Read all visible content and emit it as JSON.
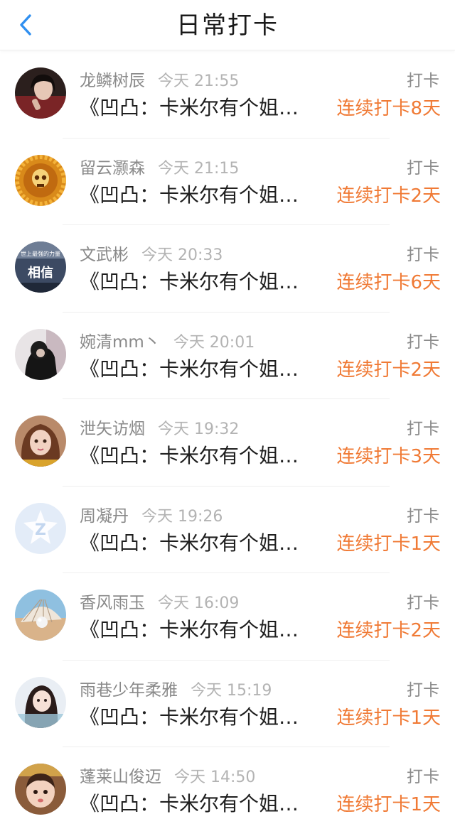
{
  "header": {
    "title": "日常打卡",
    "back_icon": "chevron-left-icon",
    "accent": "#2f8ff0"
  },
  "colors": {
    "streak": "#f07a35",
    "muted": "#8a8a8a"
  },
  "items": [
    {
      "name": "龙鳞树辰",
      "time": "今天 21:55",
      "tag": "打卡",
      "content": "《凹凸：卡米尔有个姐…",
      "streak": "连续打卡8天",
      "avatar": "avatar-girl-dark"
    },
    {
      "name": "留云灏森",
      "time": "今天 21:15",
      "tag": "打卡",
      "content": "《凹凸：卡米尔有个姐…",
      "streak": "连续打卡2天",
      "avatar": "avatar-golden-skull"
    },
    {
      "name": "文武彬",
      "time": "今天 20:33",
      "tag": "打卡",
      "content": "《凹凸：卡米尔有个姐…",
      "streak": "连续打卡6天",
      "avatar": "avatar-text-xiangxin",
      "avatar_text": "相信",
      "avatar_subtext": "世上最强的力量"
    },
    {
      "name": "婉清mm丶",
      "time": "今天 20:01",
      "tag": "打卡",
      "content": "《凹凸：卡米尔有个姐…",
      "streak": "连续打卡2天",
      "avatar": "avatar-hooded-figure"
    },
    {
      "name": "泄矢访烟",
      "time": "今天 19:32",
      "tag": "打卡",
      "content": "《凹凸：卡米尔有个姐…",
      "streak": "连续打卡3天",
      "avatar": "avatar-doll-girl"
    },
    {
      "name": "周凝丹",
      "time": "今天 19:26",
      "tag": "打卡",
      "content": "《凹凸：卡米尔有个姐…",
      "streak": "连续打卡1天",
      "avatar": "avatar-default-qzone"
    },
    {
      "name": "香风雨玉",
      "time": "今天 16:09",
      "tag": "打卡",
      "content": "《凹凸：卡米尔有个姐…",
      "streak": "连续打卡2天",
      "avatar": "avatar-pearl-shell"
    },
    {
      "name": "雨巷少年柔雅",
      "time": "今天 15:19",
      "tag": "打卡",
      "content": "《凹凸：卡米尔有个姐…",
      "streak": "连续打卡1天",
      "avatar": "avatar-girl-light"
    },
    {
      "name": "蓬莱山俊迈",
      "time": "今天 14:50",
      "tag": "打卡",
      "content": "《凹凸：卡米尔有个姐…",
      "streak": "连续打卡1天",
      "avatar": "avatar-baby"
    }
  ]
}
